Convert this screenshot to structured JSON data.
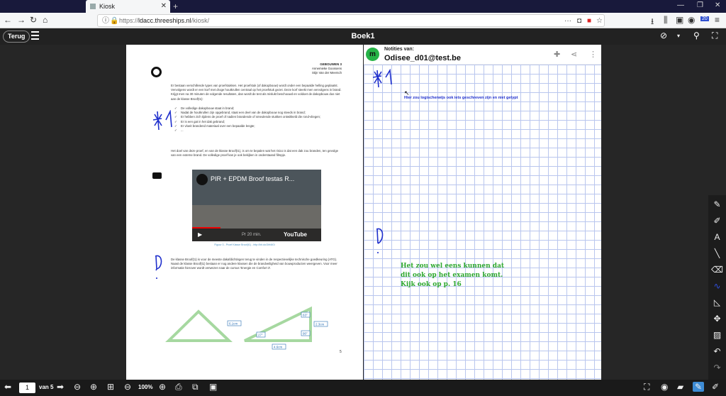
{
  "browser": {
    "tab_title": "Kiosk",
    "url_prefix": "https://",
    "url_domain": "ldacc.threeships.nl",
    "url_path": "/kiosk/",
    "badge": "20"
  },
  "app": {
    "back_label": "Terug",
    "title": "Boek1"
  },
  "page": {
    "header_title": "GEBOUWEN 3",
    "author1": "Annemieke Goossens",
    "author2": "Stijn Van der Meersch",
    "intro": "Er bestaan verschillende types van proefstukken. Het proefstuk (of dakopbouw) wordt onder een bepaalde helling geplaatst. Vervolgens wordt er een korf met droge houtkrullen centraal op het proefstuk gezet. Deze korf steekt men vervolgens in brand. Krijgt men na 30 minuten de volgende resultaten, dan wordt de test als mislukt beschouwd en voldoet de dakopbouw dus niet aan de klasse Broof(t1):",
    "bullets": [
      "De volledige dakopbouw staat in brand;",
      "Nadat de houtkrullen zijn opgebrand, staat een deel van de dakopbouw nog steeds in brand;",
      "Er hebben zich tijdens de proef of nadien brandende of smeulende stukken ontwikkeld die rond-vliegen;",
      "Er is een gat in het dak gebrand;",
      "Er vloeit brandend materiaal over een bepaalde lengte;",
      "..."
    ],
    "para2": "Het doel van deze proef, en van de klasse Broof(t1), is om te bepalen wat het risico is dat een dak zou branden, ten gevolge van een externe brand. De volledige proef kan je ook bekijken in onderstaand filmpje.",
    "video_title": "PIR + EPDM Broof testas R...",
    "video_pro": "Pr 20 min.",
    "youtube": "YouTube",
    "caption": "Figuur 3 - Proef Klasse Broof(t1) - http://bit.do/3hf4tGi",
    "para3": "De klasse Broof(t1) is voor de meeste dakafdichtingen terug te vinden in de respectievelijke technische goedkeuring (ATG). Naast de klasse Broof(t1) bestaan er nog andere klassen die de brandveiligheid van bouwproducten weergeven. Voor meer informatie hierover wordt verwezen naar de cursus 'Energie en Comfort 3'.",
    "fig_labels": [
      "6.1cm",
      "63°",
      "27°",
      "90°",
      "2.3cm",
      "4.6cm"
    ],
    "page_number": "5"
  },
  "notes": {
    "label": "Notities van:",
    "avatar_letter": "m",
    "user": "Odisee_d01@test.be",
    "blue_text": "Hier zou logischerwijs ook iets geschreven zijn en niet getypt",
    "green_line1": "Het zou wel eens kunnen dat",
    "green_line2": "dit ook op het examen komt.",
    "green_line3": "Kijk ook op p. 16"
  },
  "footer": {
    "page_value": "1",
    "of_label": "van 5",
    "zoom": "100%"
  },
  "colors": {
    "note_blue": "#1f2fcc",
    "note_green": "#2ea82e",
    "active_tool": "#3d8bd5"
  }
}
